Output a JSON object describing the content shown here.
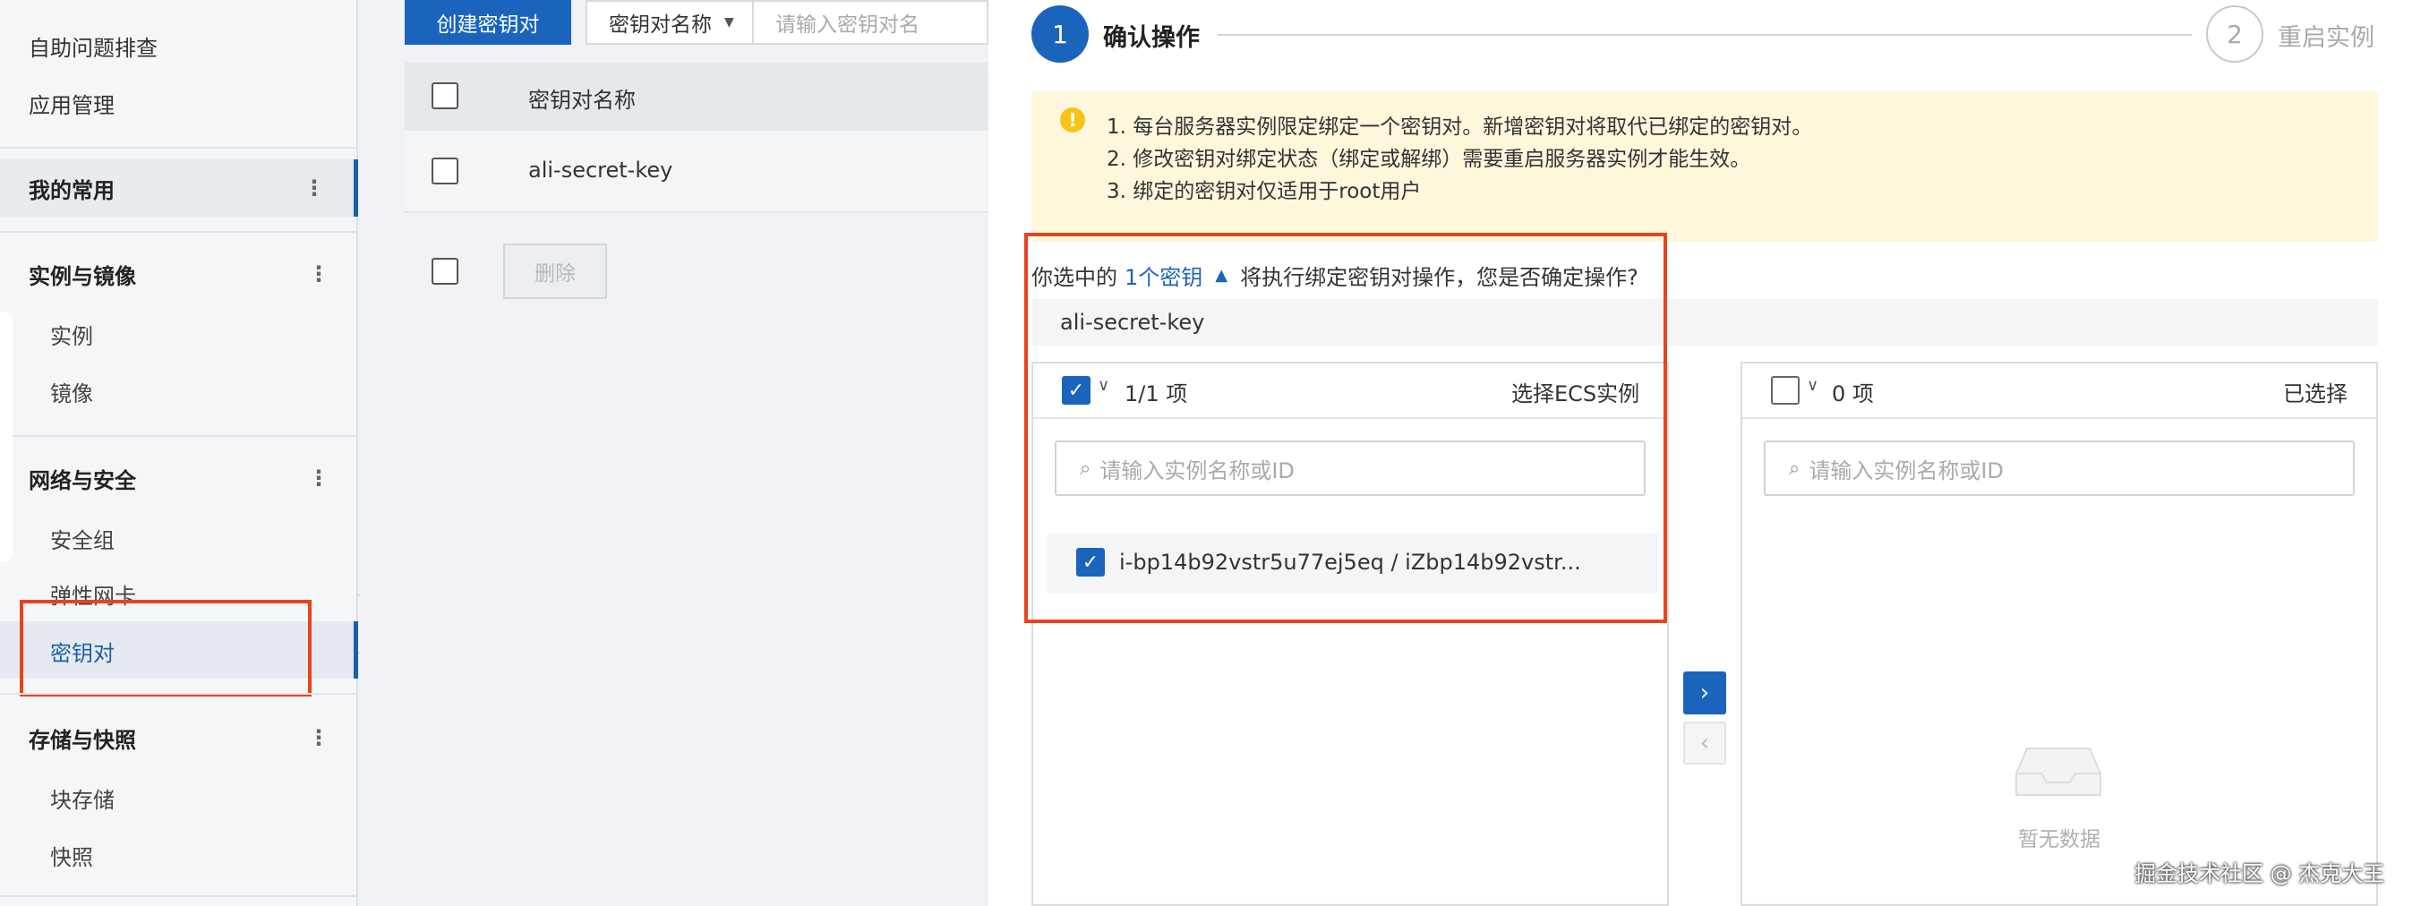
{
  "sidebar": {
    "links": [
      "自助问题排查",
      "应用管理"
    ],
    "groups": [
      {
        "label": "我的常用"
      },
      {
        "label": "实例与镜像",
        "items": [
          "实例",
          "镜像"
        ]
      },
      {
        "label": "网络与安全",
        "items": [
          "安全组",
          "弹性网卡",
          "密钥对"
        ]
      },
      {
        "label": "存储与快照",
        "items": [
          "块存储",
          "快照"
        ]
      }
    ]
  },
  "toolbar": {
    "create_label": "创建密钥对",
    "filter_label": "密钥对名称",
    "search_placeholder": "请输入密钥对名"
  },
  "table": {
    "header": "密钥对名称",
    "rows": [
      "ali-secret-key"
    ],
    "delete_label": "删除"
  },
  "steps": [
    {
      "num": "1",
      "label": "确认操作"
    },
    {
      "num": "2",
      "label": "重启实例"
    }
  ],
  "notice": {
    "lines": [
      "1. 每台服务器实例限定绑定一个密钥对。新增密钥对将取代已绑定的密钥对。",
      "2. 修改密钥对绑定状态（绑定或解绑）需要重启服务器实例才能生效。",
      "3. 绑定的密钥对仅适用于root用户"
    ]
  },
  "confirm": {
    "prefix": "你选中的",
    "link": "1个密钥",
    "suffix": "将执行绑定密钥对操作，您是否确定操作?",
    "key_name": "ali-secret-key"
  },
  "transfer": {
    "left": {
      "count": "1/1 项",
      "title": "选择ECS实例",
      "search_placeholder": "请输入实例名称或ID",
      "items": [
        "i-bp14b92vstr5u77ej5eq  /  iZbp14b92vstr..."
      ]
    },
    "right": {
      "count": "0 项",
      "title": "已选择",
      "search_placeholder": "请输入实例名称或ID",
      "empty": "暂无数据"
    }
  },
  "watermark": "掘金技术社区 @ 杰克大王",
  "colors": {
    "primary": "#1a64bd",
    "highlight": "#e8431f",
    "notice_bg": "#fef7dc"
  }
}
